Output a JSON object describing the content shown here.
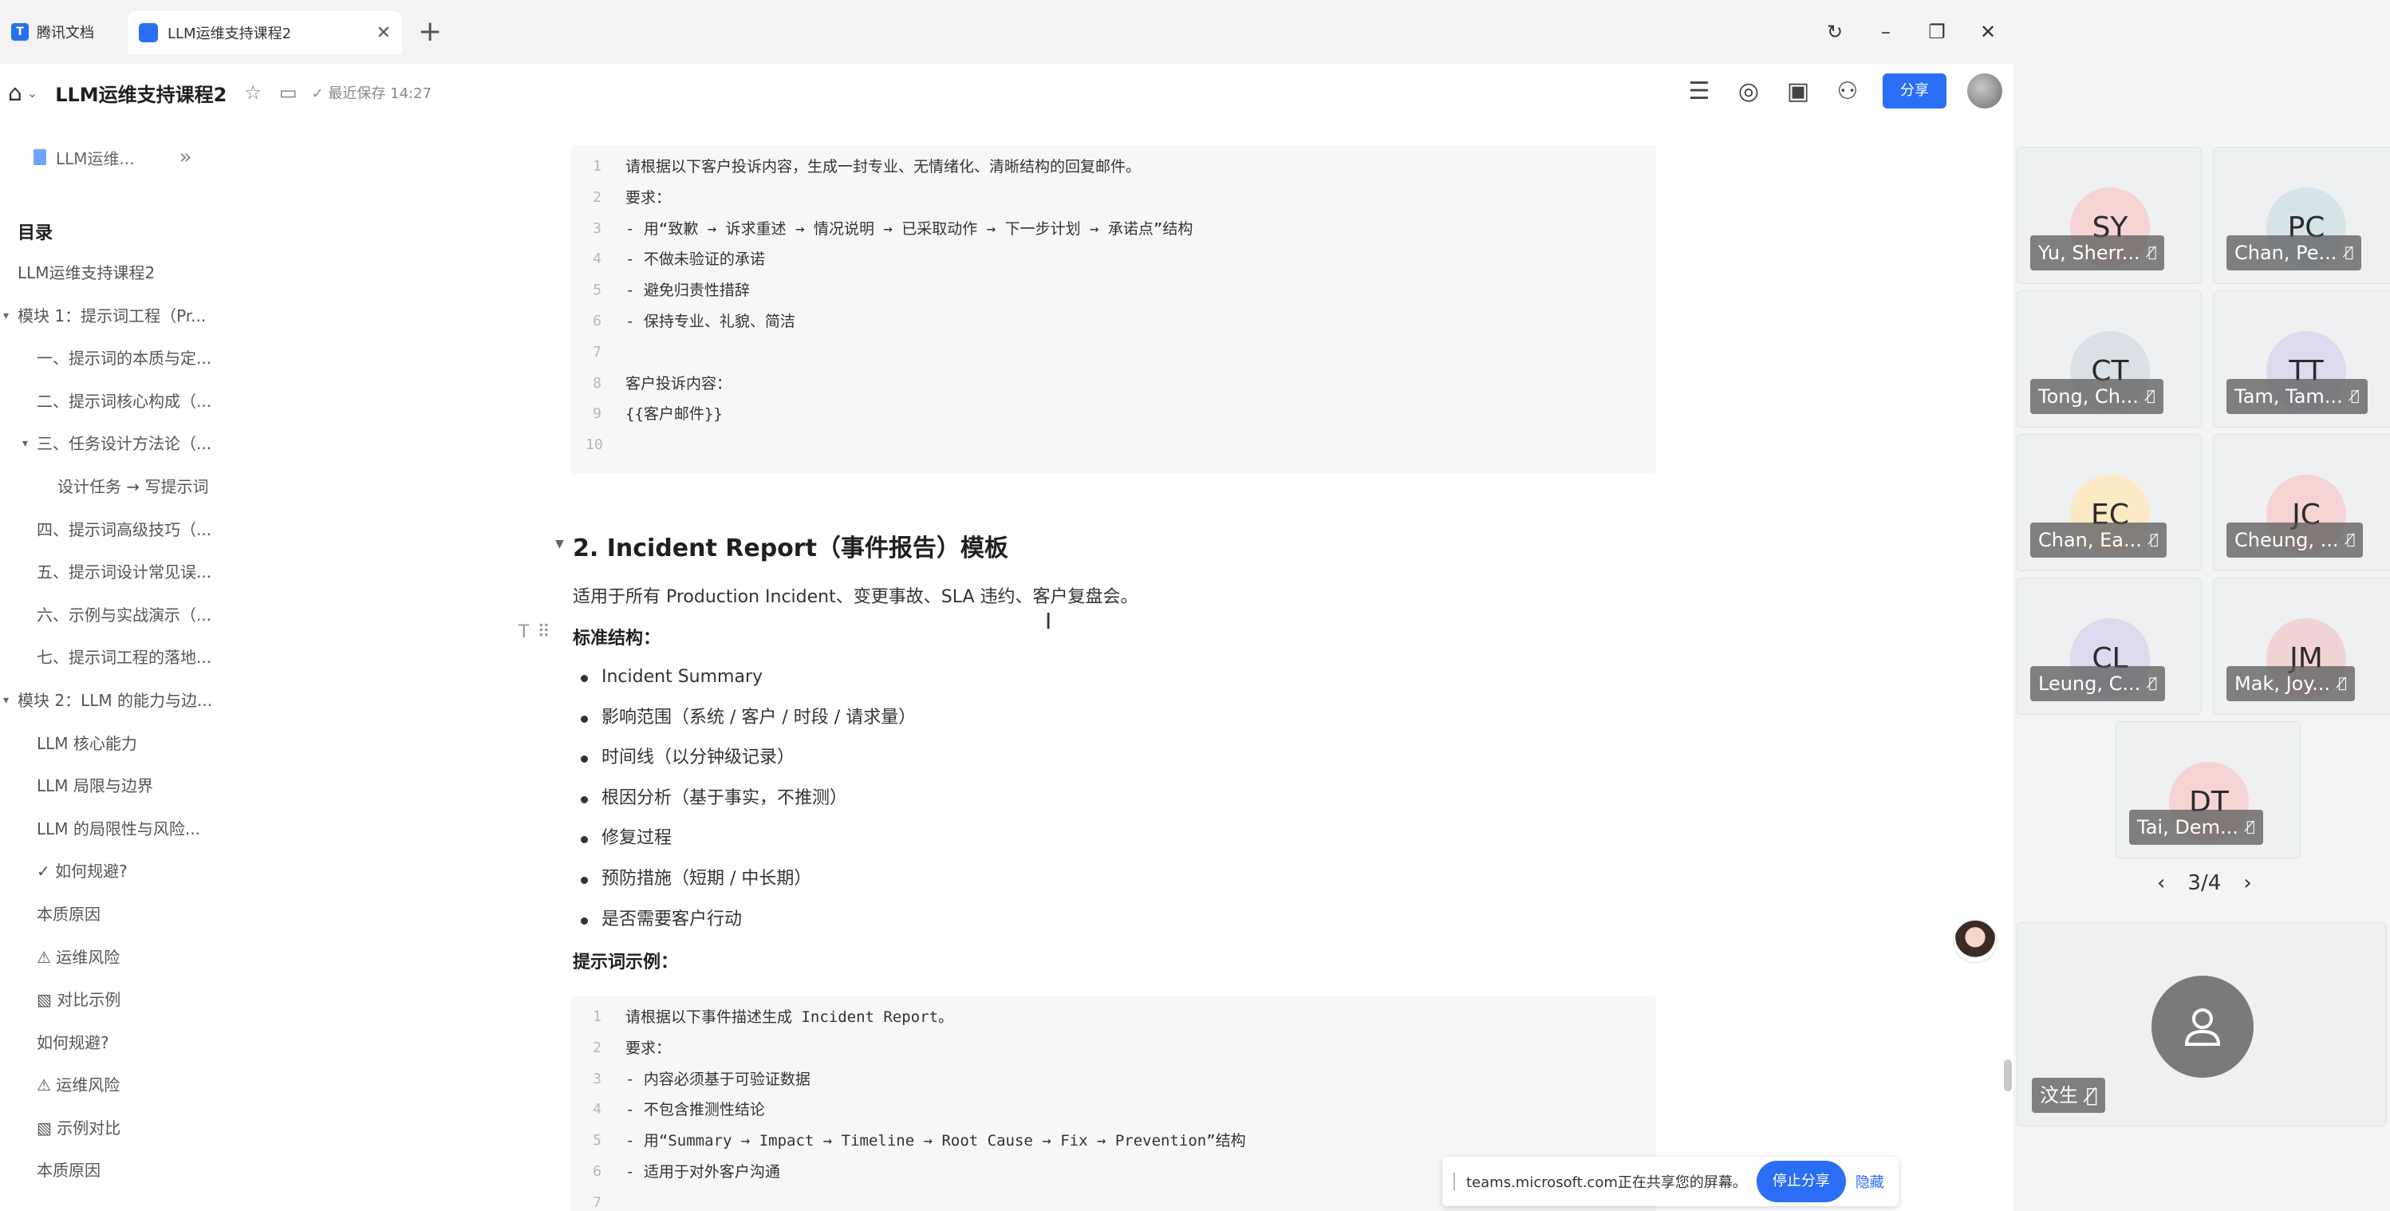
{
  "browser": {
    "app_tab_label": "腾讯文档",
    "active_tab_title": "LLM运维支持课程2",
    "new_tab_icon": "plus-icon",
    "window_controls": [
      "refresh-icon",
      "minimize-icon",
      "restore-icon",
      "close-icon"
    ]
  },
  "toolbar": {
    "doc_title": "LLM运维支持课程2",
    "saved_status": "最近保存 14:27",
    "share_label": "分享",
    "brand_color": "#2a6ef5"
  },
  "sidebar": {
    "crumb_label": "LLM运维...",
    "toc_heading": "目录",
    "items": [
      {
        "label": "LLM运维支持课程2",
        "level": 0
      },
      {
        "label": "模块 1：提示词工程（Pr...",
        "level": 0,
        "expanded": true
      },
      {
        "label": "一、提示词的本质与定...",
        "level": 1
      },
      {
        "label": "二、提示词核心构成（...",
        "level": 1
      },
      {
        "label": "三、任务设计方法论（...",
        "level": 1,
        "expanded": true
      },
      {
        "label": "设计任务 → 写提示词",
        "level": 2
      },
      {
        "label": "四、提示词高级技巧（...",
        "level": 1
      },
      {
        "label": "五、提示词设计常见误...",
        "level": 1
      },
      {
        "label": "六、示例与实战演示（...",
        "level": 1
      },
      {
        "label": "七、提示词工程的落地...",
        "level": 1
      },
      {
        "label": "模块 2：LLM 的能力与边...",
        "level": 0,
        "expanded": true
      },
      {
        "label": "LLM 核心能力",
        "level": 1
      },
      {
        "label": "LLM 局限与边界",
        "level": 1
      },
      {
        "label": "LLM 的局限性与风险...",
        "level": 1
      },
      {
        "label": "✓ 如何规避?",
        "level": 1
      },
      {
        "label": "本质原因",
        "level": 1
      },
      {
        "label": "⚠ 运维风险",
        "level": 1
      },
      {
        "label": "▧ 对比示例",
        "level": 1
      },
      {
        "label": "如何规避?",
        "level": 1
      },
      {
        "label": "⚠ 运维风险",
        "level": 1
      },
      {
        "label": "▧ 示例对比",
        "level": 1
      },
      {
        "label": "本质原因",
        "level": 1
      }
    ]
  },
  "content": {
    "code_block_1": [
      {
        "n": "1",
        "text": "请根据以下客户投诉内容，生成一封专业、无情绪化、清晰结构的回复邮件。"
      },
      {
        "n": "2",
        "text": "要求："
      },
      {
        "n": "3",
        "text": "- 用“致歉 → 诉求重述 → 情况说明 → 已采取动作 → 下一步计划 → 承诺点”结构"
      },
      {
        "n": "4",
        "text": "- 不做未验证的承诺"
      },
      {
        "n": "5",
        "text": "- 避免归责性措辞"
      },
      {
        "n": "6",
        "text": "- 保持专业、礼貌、简洁"
      },
      {
        "n": "7",
        "text": ""
      },
      {
        "n": "8",
        "text": "客户投诉内容："
      },
      {
        "n": "9",
        "text": "{{客户邮件}}"
      },
      {
        "n": "10",
        "text": ""
      }
    ],
    "section_heading": "2. Incident Report（事件报告）模板",
    "intro": "适用于所有 Production Incident、变更事故、SLA 违约、客户复盘会。",
    "structure_label": "标准结构：",
    "structure_items": [
      "Incident Summary",
      "影响范围（系统 / 客户 / 时段 / 请求量）",
      "时间线（以分钟级记录）",
      "根因分析（基于事实，不推测）",
      "修复过程",
      "预防措施（短期 / 中长期）",
      "是否需要客户行动"
    ],
    "example_label": "提示词示例：",
    "code_block_2": [
      {
        "n": "1",
        "text": "请根据以下事件描述生成 Incident Report。"
      },
      {
        "n": "2",
        "text": "要求："
      },
      {
        "n": "3",
        "text": "- 内容必须基于可验证数据"
      },
      {
        "n": "4",
        "text": "- 不包含推测性结论"
      },
      {
        "n": "5",
        "text": "- 用“Summary → Impact → Timeline → Root Cause → Fix → Prevention”结构"
      },
      {
        "n": "6",
        "text": "- 适用于对外客户沟通"
      },
      {
        "n": "7",
        "text": ""
      }
    ]
  },
  "share_banner": {
    "text": "teams.microsoft.com正在共享您的屏幕。",
    "stop_label": "停止分享",
    "hide_label": "隐藏"
  },
  "teams": {
    "participants": [
      {
        "initials": "SY",
        "name": "Yu, Sherr...",
        "color": "#f6d3d3"
      },
      {
        "initials": "PC",
        "name": "Chan, Pe...",
        "color": "#d6e4ea"
      },
      {
        "initials": "CT",
        "name": "Tong, Ch...",
        "color": "#d9e1e6"
      },
      {
        "initials": "TT",
        "name": "Tam, Tam...",
        "color": "#ddd9ee"
      },
      {
        "initials": "EC",
        "name": "Chan, Ea...",
        "color": "#fbeac3"
      },
      {
        "initials": "JC",
        "name": "Cheung, ...",
        "color": "#f6d3d3"
      },
      {
        "initials": "CL",
        "name": "Leung, C...",
        "color": "#ddd9ee"
      },
      {
        "initials": "JM",
        "name": "Mak, Joy...",
        "color": "#f0d4d4"
      },
      {
        "initials": "DT",
        "name": "Tai, Dem...",
        "color": "#f6d3d3"
      }
    ],
    "page_indicator": "3/4",
    "self_name": "汶生"
  }
}
